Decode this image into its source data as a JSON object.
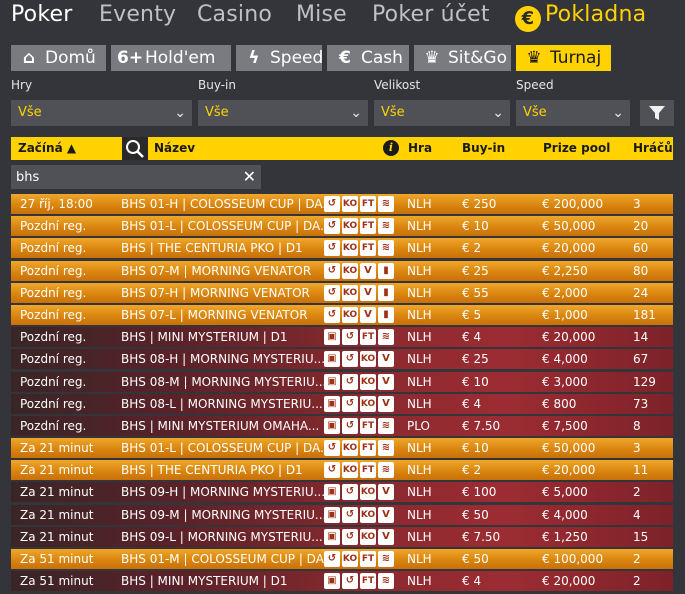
{
  "topnav": {
    "poker": "Poker",
    "eventy": "Eventy",
    "casino": "Casino",
    "mise": "Mise",
    "poker_ucet": "Poker účet",
    "pokladna": "Pokladna",
    "coin_glyph": "€"
  },
  "tabs": [
    {
      "icon": "⌂",
      "label": "Domů"
    },
    {
      "icon": "6+",
      "label": "Hold'em"
    },
    {
      "icon": "ϟ",
      "label": "Speed"
    },
    {
      "icon": "€",
      "label": "Cash"
    },
    {
      "icon": "♛",
      "label": "Sit&Go"
    },
    {
      "icon": "♛",
      "label": "Turnaj"
    }
  ],
  "filters": {
    "hry": {
      "label": "Hry",
      "value": "Vše"
    },
    "buyin": {
      "label": "Buy-in",
      "value": "Vše"
    },
    "velikost": {
      "label": "Velikost",
      "value": "Vše"
    },
    "speed": {
      "label": "Speed",
      "value": "Vše"
    },
    "chevron": "⌄"
  },
  "table": {
    "headers": {
      "starts": "Začíná ▲",
      "name": "Název",
      "info": "i",
      "game": "Hra",
      "buyin": "Buy-in",
      "prize": "Prize pool",
      "players": "Hráčů"
    },
    "search": {
      "value": "bhs",
      "clear": "✕"
    },
    "rows": [
      {
        "style": "orange",
        "starts": "27 říj, 18:00",
        "name": "BHS 01-H | COLOSSEUM CUP | DA...",
        "badges": [
          "↺",
          "KO",
          "FT",
          "≋"
        ],
        "game": "NLH",
        "buyin": "€ 250",
        "prize": "€ 200,000",
        "players": "3"
      },
      {
        "style": "orange",
        "starts": "Pozdní reg.",
        "name": "BHS 01-L | COLOSSEUM CUP | DA...",
        "badges": [
          "↺",
          "KO",
          "FT",
          "≋"
        ],
        "game": "NLH",
        "buyin": "€ 10",
        "prize": "€ 50,000",
        "players": "20"
      },
      {
        "style": "orange",
        "starts": "Pozdní reg.",
        "name": "BHS | THE CENTURIA PKO | D1",
        "badges": [
          "↺",
          "KO",
          "FT",
          "≋"
        ],
        "game": "NLH",
        "buyin": "€ 2",
        "prize": "€ 20,000",
        "players": "60"
      },
      {
        "style": "orange",
        "starts": "Pozdní reg.",
        "name": "BHS 07-M | MORNING VENATOR",
        "badges": [
          "↺",
          "KO",
          "V",
          "▮"
        ],
        "game": "NLH",
        "buyin": "€ 25",
        "prize": "€ 2,250",
        "players": "80"
      },
      {
        "style": "orange",
        "starts": "Pozdní reg.",
        "name": "BHS 07-H | MORNING VENATOR",
        "badges": [
          "↺",
          "KO",
          "V",
          "▮"
        ],
        "game": "NLH",
        "buyin": "€ 55",
        "prize": "€ 2,000",
        "players": "24"
      },
      {
        "style": "orange",
        "starts": "Pozdní reg.",
        "name": "BHS 07-L | MORNING VENATOR",
        "badges": [
          "↺",
          "KO",
          "V",
          "▮"
        ],
        "game": "NLH",
        "buyin": "€ 5",
        "prize": "€ 1,000",
        "players": "181"
      },
      {
        "style": "red",
        "starts": "Pozdní reg.",
        "name": "BHS | MINI MYSTERIUM | D1",
        "badges": [
          "▣",
          "↺",
          "FT",
          "≋"
        ],
        "game": "NLH",
        "buyin": "€ 4",
        "prize": "€ 20,000",
        "players": "14"
      },
      {
        "style": "red",
        "starts": "Pozdní reg.",
        "name": "BHS 08-H | MORNING MYSTERIU...",
        "badges": [
          "▣",
          "↺",
          "KO",
          "V"
        ],
        "game": "NLH",
        "buyin": "€ 25",
        "prize": "€ 4,000",
        "players": "67"
      },
      {
        "style": "red",
        "starts": "Pozdní reg.",
        "name": "BHS 08-M | MORNING MYSTERIU...",
        "badges": [
          "▣",
          "↺",
          "KO",
          "V"
        ],
        "game": "NLH",
        "buyin": "€ 10",
        "prize": "€ 3,000",
        "players": "129"
      },
      {
        "style": "red",
        "starts": "Pozdní reg.",
        "name": "BHS 08-L | MORNING MYSTERIU...",
        "badges": [
          "▣",
          "↺",
          "KO",
          "V"
        ],
        "game": "NLH",
        "buyin": "€ 4",
        "prize": "€ 800",
        "players": "73"
      },
      {
        "style": "red",
        "starts": "Pozdní reg.",
        "name": "BHS | MINI MYSTERIUM OMAHA...",
        "badges": [
          "▣",
          "↺",
          "FT",
          "≋"
        ],
        "game": "PLO",
        "buyin": "€ 7.50",
        "prize": "€ 7,500",
        "players": "8"
      },
      {
        "style": "orange",
        "starts": "Za 21 minut",
        "name": "BHS 01-L | COLOSSEUM CUP | DA...",
        "badges": [
          "↺",
          "KO",
          "FT",
          "≋"
        ],
        "game": "NLH",
        "buyin": "€ 10",
        "prize": "€ 50,000",
        "players": "3"
      },
      {
        "style": "orange",
        "starts": "Za 21 minut",
        "name": "BHS | THE CENTURIA PKO | D1",
        "badges": [
          "↺",
          "KO",
          "FT",
          "≋"
        ],
        "game": "NLH",
        "buyin": "€ 2",
        "prize": "€ 20,000",
        "players": "11"
      },
      {
        "style": "red",
        "starts": "Za 21 minut",
        "name": "BHS 09-H | MORNING MYSTERIU...",
        "badges": [
          "▣",
          "↺",
          "KO",
          "V"
        ],
        "game": "NLH",
        "buyin": "€ 100",
        "prize": "€ 5,000",
        "players": "2"
      },
      {
        "style": "red",
        "starts": "Za 21 minut",
        "name": "BHS 09-M | MORNING MYSTERIU...",
        "badges": [
          "▣",
          "↺",
          "KO",
          "V"
        ],
        "game": "NLH",
        "buyin": "€ 50",
        "prize": "€ 4,000",
        "players": "4"
      },
      {
        "style": "red",
        "starts": "Za 21 minut",
        "name": "BHS 09-L | MORNING MYSTERIU...",
        "badges": [
          "▣",
          "↺",
          "KO",
          "V"
        ],
        "game": "NLH",
        "buyin": "€ 7.50",
        "prize": "€ 1,250",
        "players": "15"
      },
      {
        "style": "orange",
        "starts": "Za 51 minut",
        "name": "BHS 01-M | COLOSSEUM CUP | DA...",
        "badges": [
          "↺",
          "KO",
          "FT",
          "≋"
        ],
        "game": "NLH",
        "buyin": "€ 50",
        "prize": "€ 100,000",
        "players": "2"
      },
      {
        "style": "red",
        "starts": "Za 51 minut",
        "name": "BHS | MINI MYSTERIUM | D1",
        "badges": [
          "▣",
          "↺",
          "FT",
          "≋"
        ],
        "game": "NLH",
        "buyin": "€ 4",
        "prize": "€ 20,000",
        "players": "2"
      }
    ]
  },
  "colors": {
    "accent": "#ffd200",
    "bg": "#34353a",
    "tab": "#7a7b80",
    "row_orange": "#e09419",
    "row_red": "#8a2a2f"
  }
}
